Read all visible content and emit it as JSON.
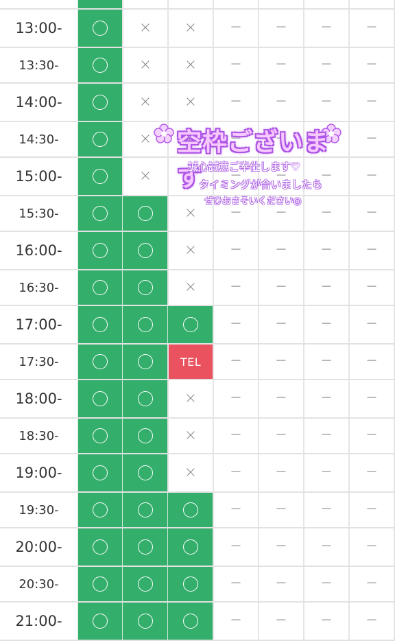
{
  "schedule": {
    "symbols": {
      "ok": "〇",
      "full": "×",
      "none": "－",
      "tel": "TEL"
    },
    "colors": {
      "ok": "#33ae6b",
      "tel": "#e9525e",
      "grid": "#e2e2e2"
    },
    "rows": [
      {
        "time": "13:00-",
        "cells": [
          "ok",
          "full",
          "full",
          "none",
          "none",
          "none",
          "none"
        ]
      },
      {
        "time": "13:30-",
        "cells": [
          "ok",
          "full",
          "full",
          "none",
          "none",
          "none",
          "none"
        ]
      },
      {
        "time": "14:00-",
        "cells": [
          "ok",
          "full",
          "full",
          "none",
          "none",
          "none",
          "none"
        ]
      },
      {
        "time": "14:30-",
        "cells": [
          "ok",
          "full",
          "full",
          "none",
          "none",
          "none",
          "none"
        ]
      },
      {
        "time": "15:00-",
        "cells": [
          "ok",
          "full",
          "full",
          "none",
          "none",
          "none",
          "none"
        ]
      },
      {
        "time": "15:30-",
        "cells": [
          "ok",
          "ok",
          "full",
          "none",
          "none",
          "none",
          "none"
        ]
      },
      {
        "time": "16:00-",
        "cells": [
          "ok",
          "ok",
          "full",
          "none",
          "none",
          "none",
          "none"
        ]
      },
      {
        "time": "16:30-",
        "cells": [
          "ok",
          "ok",
          "full",
          "none",
          "none",
          "none",
          "none"
        ]
      },
      {
        "time": "17:00-",
        "cells": [
          "ok",
          "ok",
          "ok",
          "none",
          "none",
          "none",
          "none"
        ]
      },
      {
        "time": "17:30-",
        "cells": [
          "ok",
          "ok",
          "tel",
          "none",
          "none",
          "none",
          "none"
        ]
      },
      {
        "time": "18:00-",
        "cells": [
          "ok",
          "ok",
          "full",
          "none",
          "none",
          "none",
          "none"
        ]
      },
      {
        "time": "18:30-",
        "cells": [
          "ok",
          "ok",
          "full",
          "none",
          "none",
          "none",
          "none"
        ]
      },
      {
        "time": "19:00-",
        "cells": [
          "ok",
          "ok",
          "full",
          "none",
          "none",
          "none",
          "none"
        ]
      },
      {
        "time": "19:30-",
        "cells": [
          "ok",
          "ok",
          "ok",
          "none",
          "none",
          "none",
          "none"
        ]
      },
      {
        "time": "20:00-",
        "cells": [
          "ok",
          "ok",
          "ok",
          "none",
          "none",
          "none",
          "none"
        ]
      },
      {
        "time": "20:30-",
        "cells": [
          "ok",
          "ok",
          "ok",
          "none",
          "none",
          "none",
          "none"
        ]
      },
      {
        "time": "21:00-",
        "cells": [
          "ok",
          "ok",
          "ok",
          "none",
          "none",
          "none",
          "none"
        ]
      }
    ]
  },
  "overlay": {
    "title": "空枠ございます",
    "line1": "誠心誠意ご奉仕します♡",
    "line2": "タイミングが合いましたら",
    "line3": "ぜひおさそいください◎"
  }
}
